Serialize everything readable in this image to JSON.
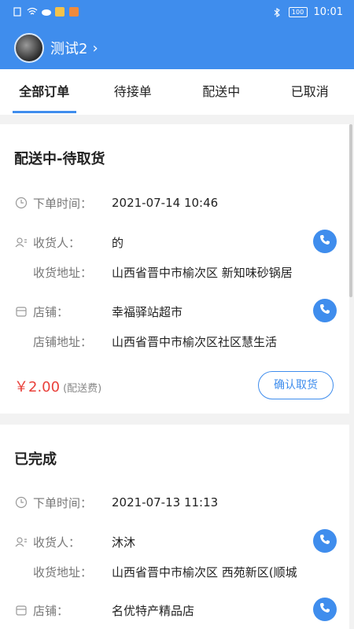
{
  "status_bar": {
    "time": "10:01",
    "battery": "100"
  },
  "header": {
    "username": "测试2",
    "chevron": "›"
  },
  "tabs": [
    {
      "label": "全部订单"
    },
    {
      "label": "待接单"
    },
    {
      "label": "配送中"
    },
    {
      "label": "已取消"
    }
  ],
  "orders": [
    {
      "status": "配送中-待取货",
      "order_time_label": "下单时间：",
      "order_time": "2021-07-14 10:46",
      "recipient_label": "收货人：",
      "recipient": "的",
      "address_label": "收货地址：",
      "address": "山西省晋中市榆次区 新知味砂锅居",
      "shop_label": "店铺：",
      "shop": "幸福驿站超市",
      "shop_address_label": "店铺地址：",
      "shop_address": "山西省晋中市榆次区社区慧生活",
      "price": "￥2.00",
      "price_note": "(配送费)",
      "action": "确认取货"
    },
    {
      "status": "已完成",
      "order_time_label": "下单时间：",
      "order_time": "2021-07-13 11:13",
      "recipient_label": "收货人：",
      "recipient": "沐沐",
      "address_label": "收货地址：",
      "address": "山西省晋中市榆次区 西苑新区(顺城",
      "shop_label": "店铺：",
      "shop": "名优特产精品店"
    }
  ]
}
